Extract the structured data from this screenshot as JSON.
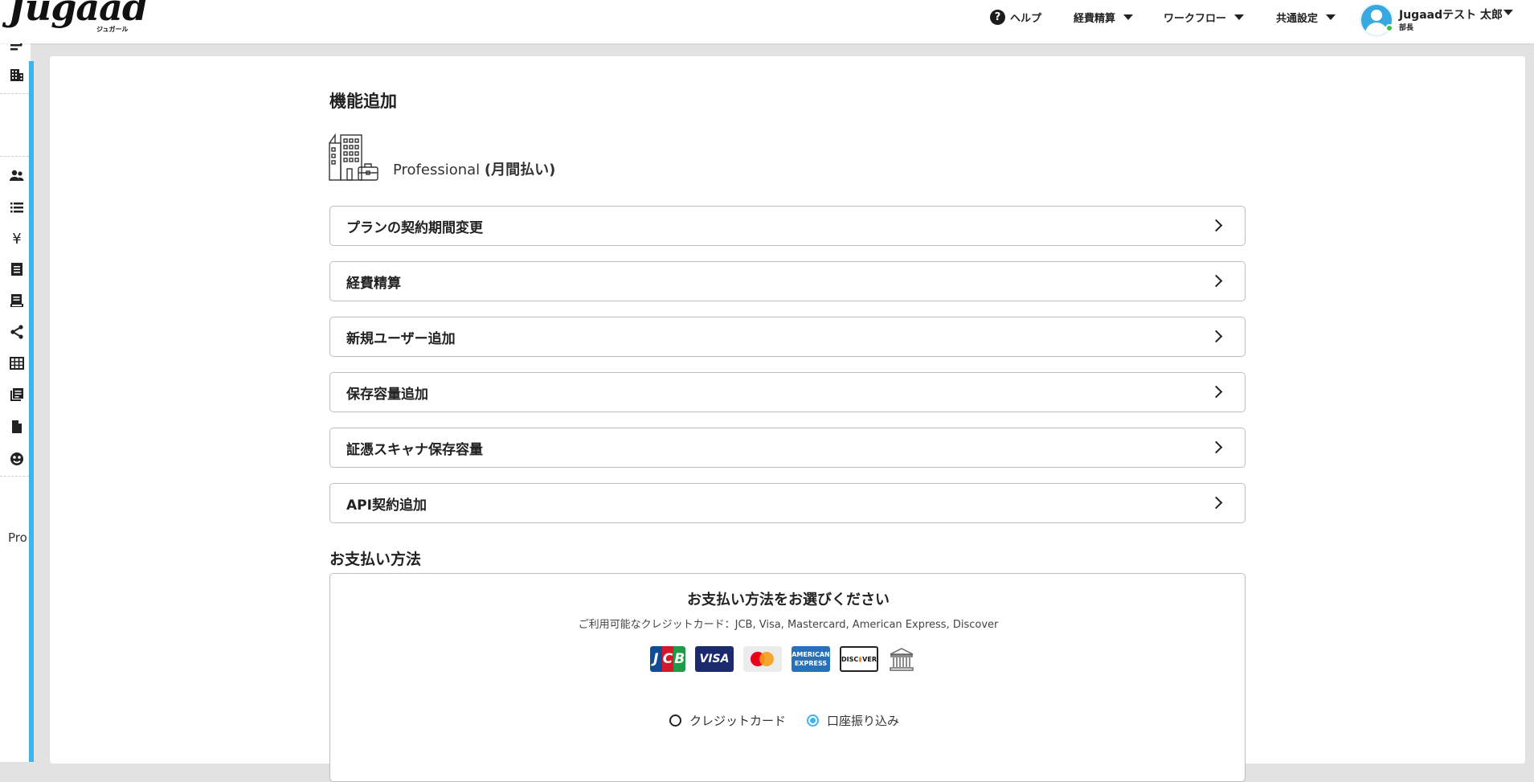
{
  "header": {
    "logo": "Jugaad",
    "logo_sub": "ジュガール",
    "nav": {
      "help": "ヘルプ",
      "expense": "経費精算",
      "workflow": "ワークフロー",
      "common_settings": "共通設定"
    },
    "user": {
      "name": "Jugaadテスト 太郎",
      "role": "部長"
    }
  },
  "sidebar": {
    "truncated_label": "Pro"
  },
  "main": {
    "title": "機能追加",
    "plan": {
      "name": "Professional",
      "billing": "(月間払い)"
    },
    "options": [
      {
        "label": "プランの契約期間変更"
      },
      {
        "label": "経費精算"
      },
      {
        "label": "新規ユーザー追加"
      },
      {
        "label": "保存容量追加"
      },
      {
        "label": "証憑スキャナ保存容量"
      },
      {
        "label": "API契約追加"
      }
    ],
    "payment": {
      "section_title": "お支払い方法",
      "heading": "お支払い方法をお選びください",
      "available_cards": "ご利用可能なクレジットカード：JCB, Visa, Mastercard, American Express, Discover",
      "card_logos": {
        "jcb": [
          "J",
          "C",
          "B"
        ],
        "visa": "VISA",
        "amex_line1": "AMERICAN",
        "amex_line2": "EXPRESS",
        "discover_left": "DISC",
        "discover_right": "VER"
      },
      "methods": [
        {
          "label": "クレジットカード",
          "selected": false
        },
        {
          "label": "口座振り込み",
          "selected": true
        }
      ]
    }
  },
  "colors": {
    "accent": "#3fb4ea",
    "background": "#e2e2e2",
    "online": "#3fbf4a",
    "visa": "#1a2a6c",
    "amex": "#2671b9"
  }
}
